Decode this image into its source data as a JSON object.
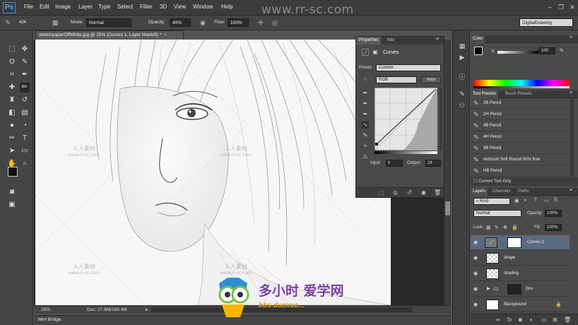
{
  "app": {
    "logo": "Ps",
    "menus": [
      "File",
      "Edit",
      "Image",
      "Layer",
      "Type",
      "Select",
      "Filter",
      "3D",
      "View",
      "Window",
      "Help"
    ],
    "watermark": "www.rr-sc.com"
  },
  "options_bar": {
    "brush_size": "424",
    "mode_label": "Mode:",
    "mode_value": "Normal",
    "opacity_label": "Opacity:",
    "opacity_value": "40%",
    "flow_label": "Flow:",
    "flow_value": "100%",
    "workspace": "DigitalDrawing"
  },
  "document": {
    "tab_title": "sketchpaperOffWhite.jpg @ 25% (Curves 1, Layer Mask/8) *",
    "zoom": "25%",
    "doc_info": "Doc: 27.8M/166.4M",
    "mini_bridge": "Mini Bridge",
    "watermark_cn": "人人素材",
    "watermark_url": "www.rr-sc.com"
  },
  "properties": {
    "tabs": [
      "Properties",
      "Info"
    ],
    "adjustment": "Curves",
    "preset_label": "Preset:",
    "preset_value": "Custom",
    "channel": "RGB",
    "auto_label": "Auto",
    "input_label": "Input:",
    "input_value": "0",
    "output_label": "Output:",
    "output_value": "28"
  },
  "color_panel": {
    "tab": "Color",
    "k_value": "100",
    "unit": "%"
  },
  "tool_presets": {
    "tabs": [
      "Tool Presets",
      "Brush Presets"
    ],
    "items": [
      "2B Pencil",
      "2H Pencil",
      "4B Pencil",
      "4H Pencil",
      "9B Pencil",
      "Airbrush Soft Round 50% flow",
      "HB Pencil"
    ],
    "current_only": "Current Tool Only"
  },
  "layers_panel": {
    "tabs": [
      "Layers",
      "Channels",
      "Paths"
    ],
    "kind": "Kind",
    "blend": "Normal",
    "opacity_label": "Opacity:",
    "opacity_value": "100%",
    "lock_label": "Lock:",
    "fill_label": "Fill:",
    "fill_value": "100%",
    "layers": [
      {
        "name": "Curves 1"
      },
      {
        "name": "shape"
      },
      {
        "name": "shading"
      },
      {
        "name": "Gro"
      },
      {
        "name": "Background"
      }
    ]
  },
  "overlay_logo": {
    "text": "多小时 爱学网",
    "url": "bbs.duoxue..."
  }
}
